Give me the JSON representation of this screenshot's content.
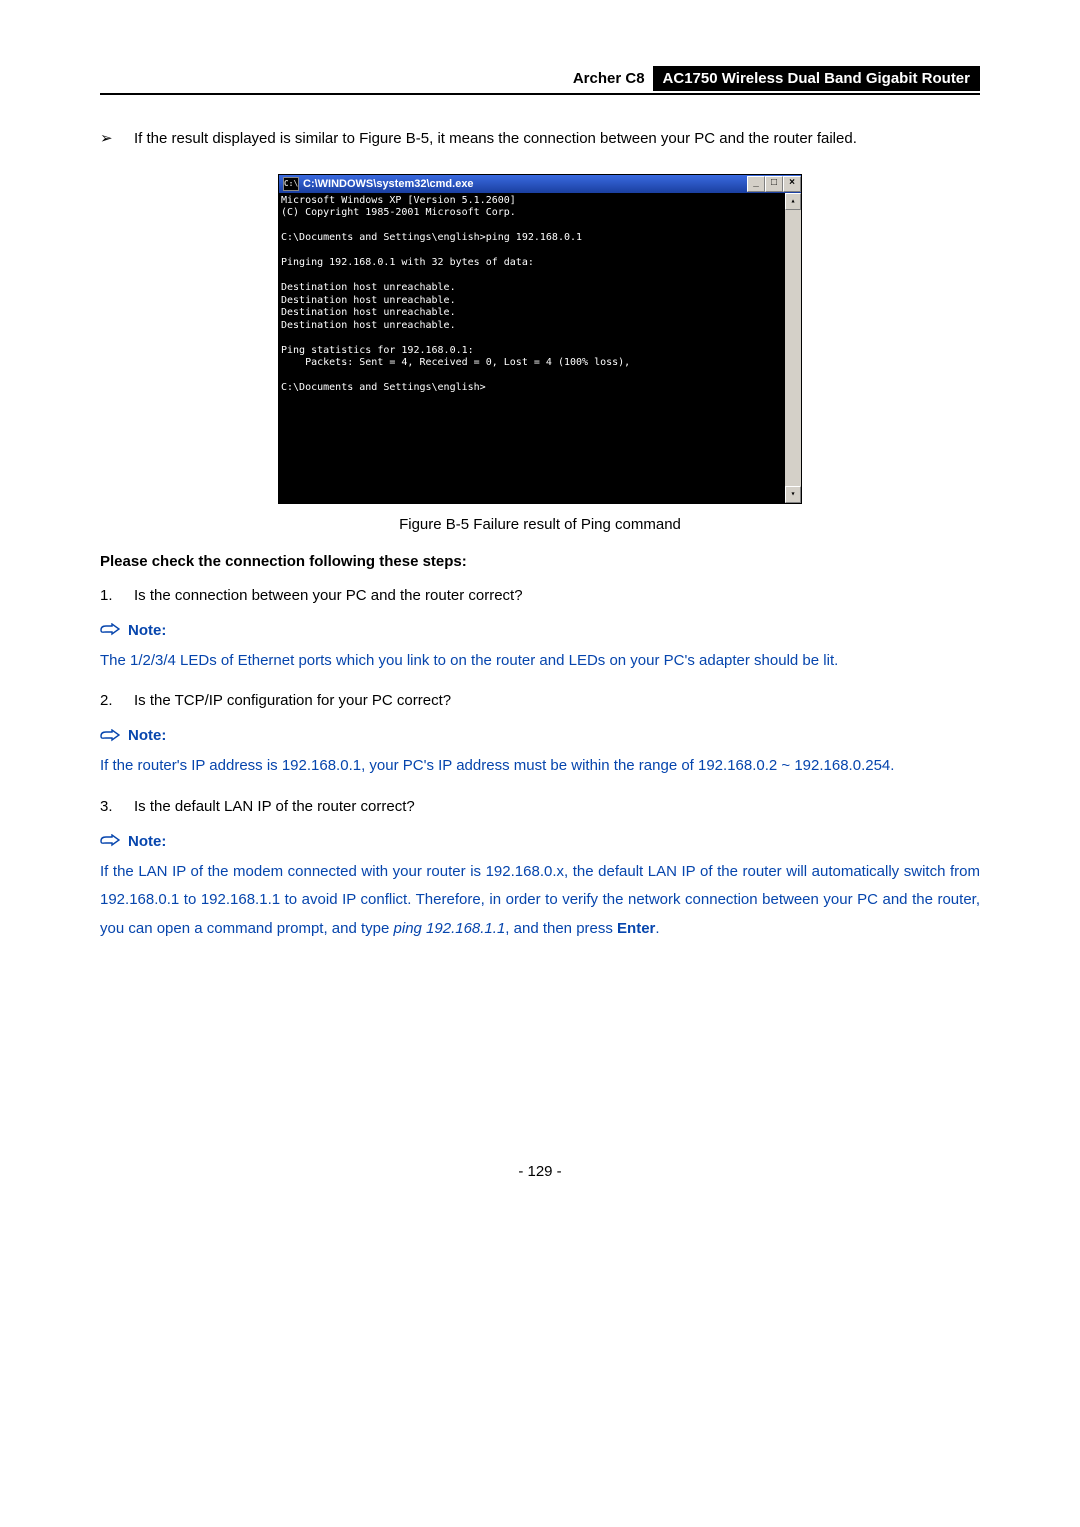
{
  "header": {
    "model": "Archer C8",
    "product": "AC1750 Wireless Dual Band Gigabit Router"
  },
  "intro_bullet": "If the result displayed is similar to Figure B-5, it means the connection between your PC and the router failed.",
  "cmd": {
    "icon_label": "C:\\",
    "title": "C:\\WINDOWS\\system32\\cmd.exe",
    "btn_min": "_",
    "btn_max": "□",
    "btn_close": "×",
    "scroll_up": "▴",
    "scroll_down": "▾",
    "lines": "Microsoft Windows XP [Version 5.1.2600]\n(C) Copyright 1985-2001 Microsoft Corp.\n\nC:\\Documents and Settings\\english>ping 192.168.0.1\n\nPinging 192.168.0.1 with 32 bytes of data:\n\nDestination host unreachable.\nDestination host unreachable.\nDestination host unreachable.\nDestination host unreachable.\n\nPing statistics for 192.168.0.1:\n    Packets: Sent = 4, Received = 0, Lost = 4 (100% loss),\n\nC:\\Documents and Settings\\english>"
  },
  "figure_caption": "Figure B-5 Failure result of Ping command",
  "check_heading": "Please check the connection following these steps:",
  "steps": {
    "n1": "1.",
    "q1": "Is the connection between your PC and the router correct?",
    "n2": "2.",
    "q2": "Is the TCP/IP configuration for your PC correct?",
    "n3": "3.",
    "q3": "Is the default LAN IP of the router correct?"
  },
  "note_label": "Note:",
  "note1": "The 1/2/3/4 LEDs of Ethernet ports which you link to on the router and LEDs on your PC's adapter should be lit.",
  "note2": "If the router's IP address is 192.168.0.1, your PC's IP address must be within the range of 192.168.0.2 ~ 192.168.0.254.",
  "note3_a": "If the LAN IP of the modem connected with your router is 192.168.0.x, the default LAN IP of the router will automatically switch from 192.168.0.1 to 192.168.1.1 to avoid IP conflict. Therefore, in order to verify the network connection between your PC and the router, you can open a command prompt, and type ",
  "note3_cmd": "ping 192.168.1.1",
  "note3_b": ", and then press ",
  "note3_enter": "Enter",
  "note3_c": ".",
  "page_number": "- 129 -"
}
